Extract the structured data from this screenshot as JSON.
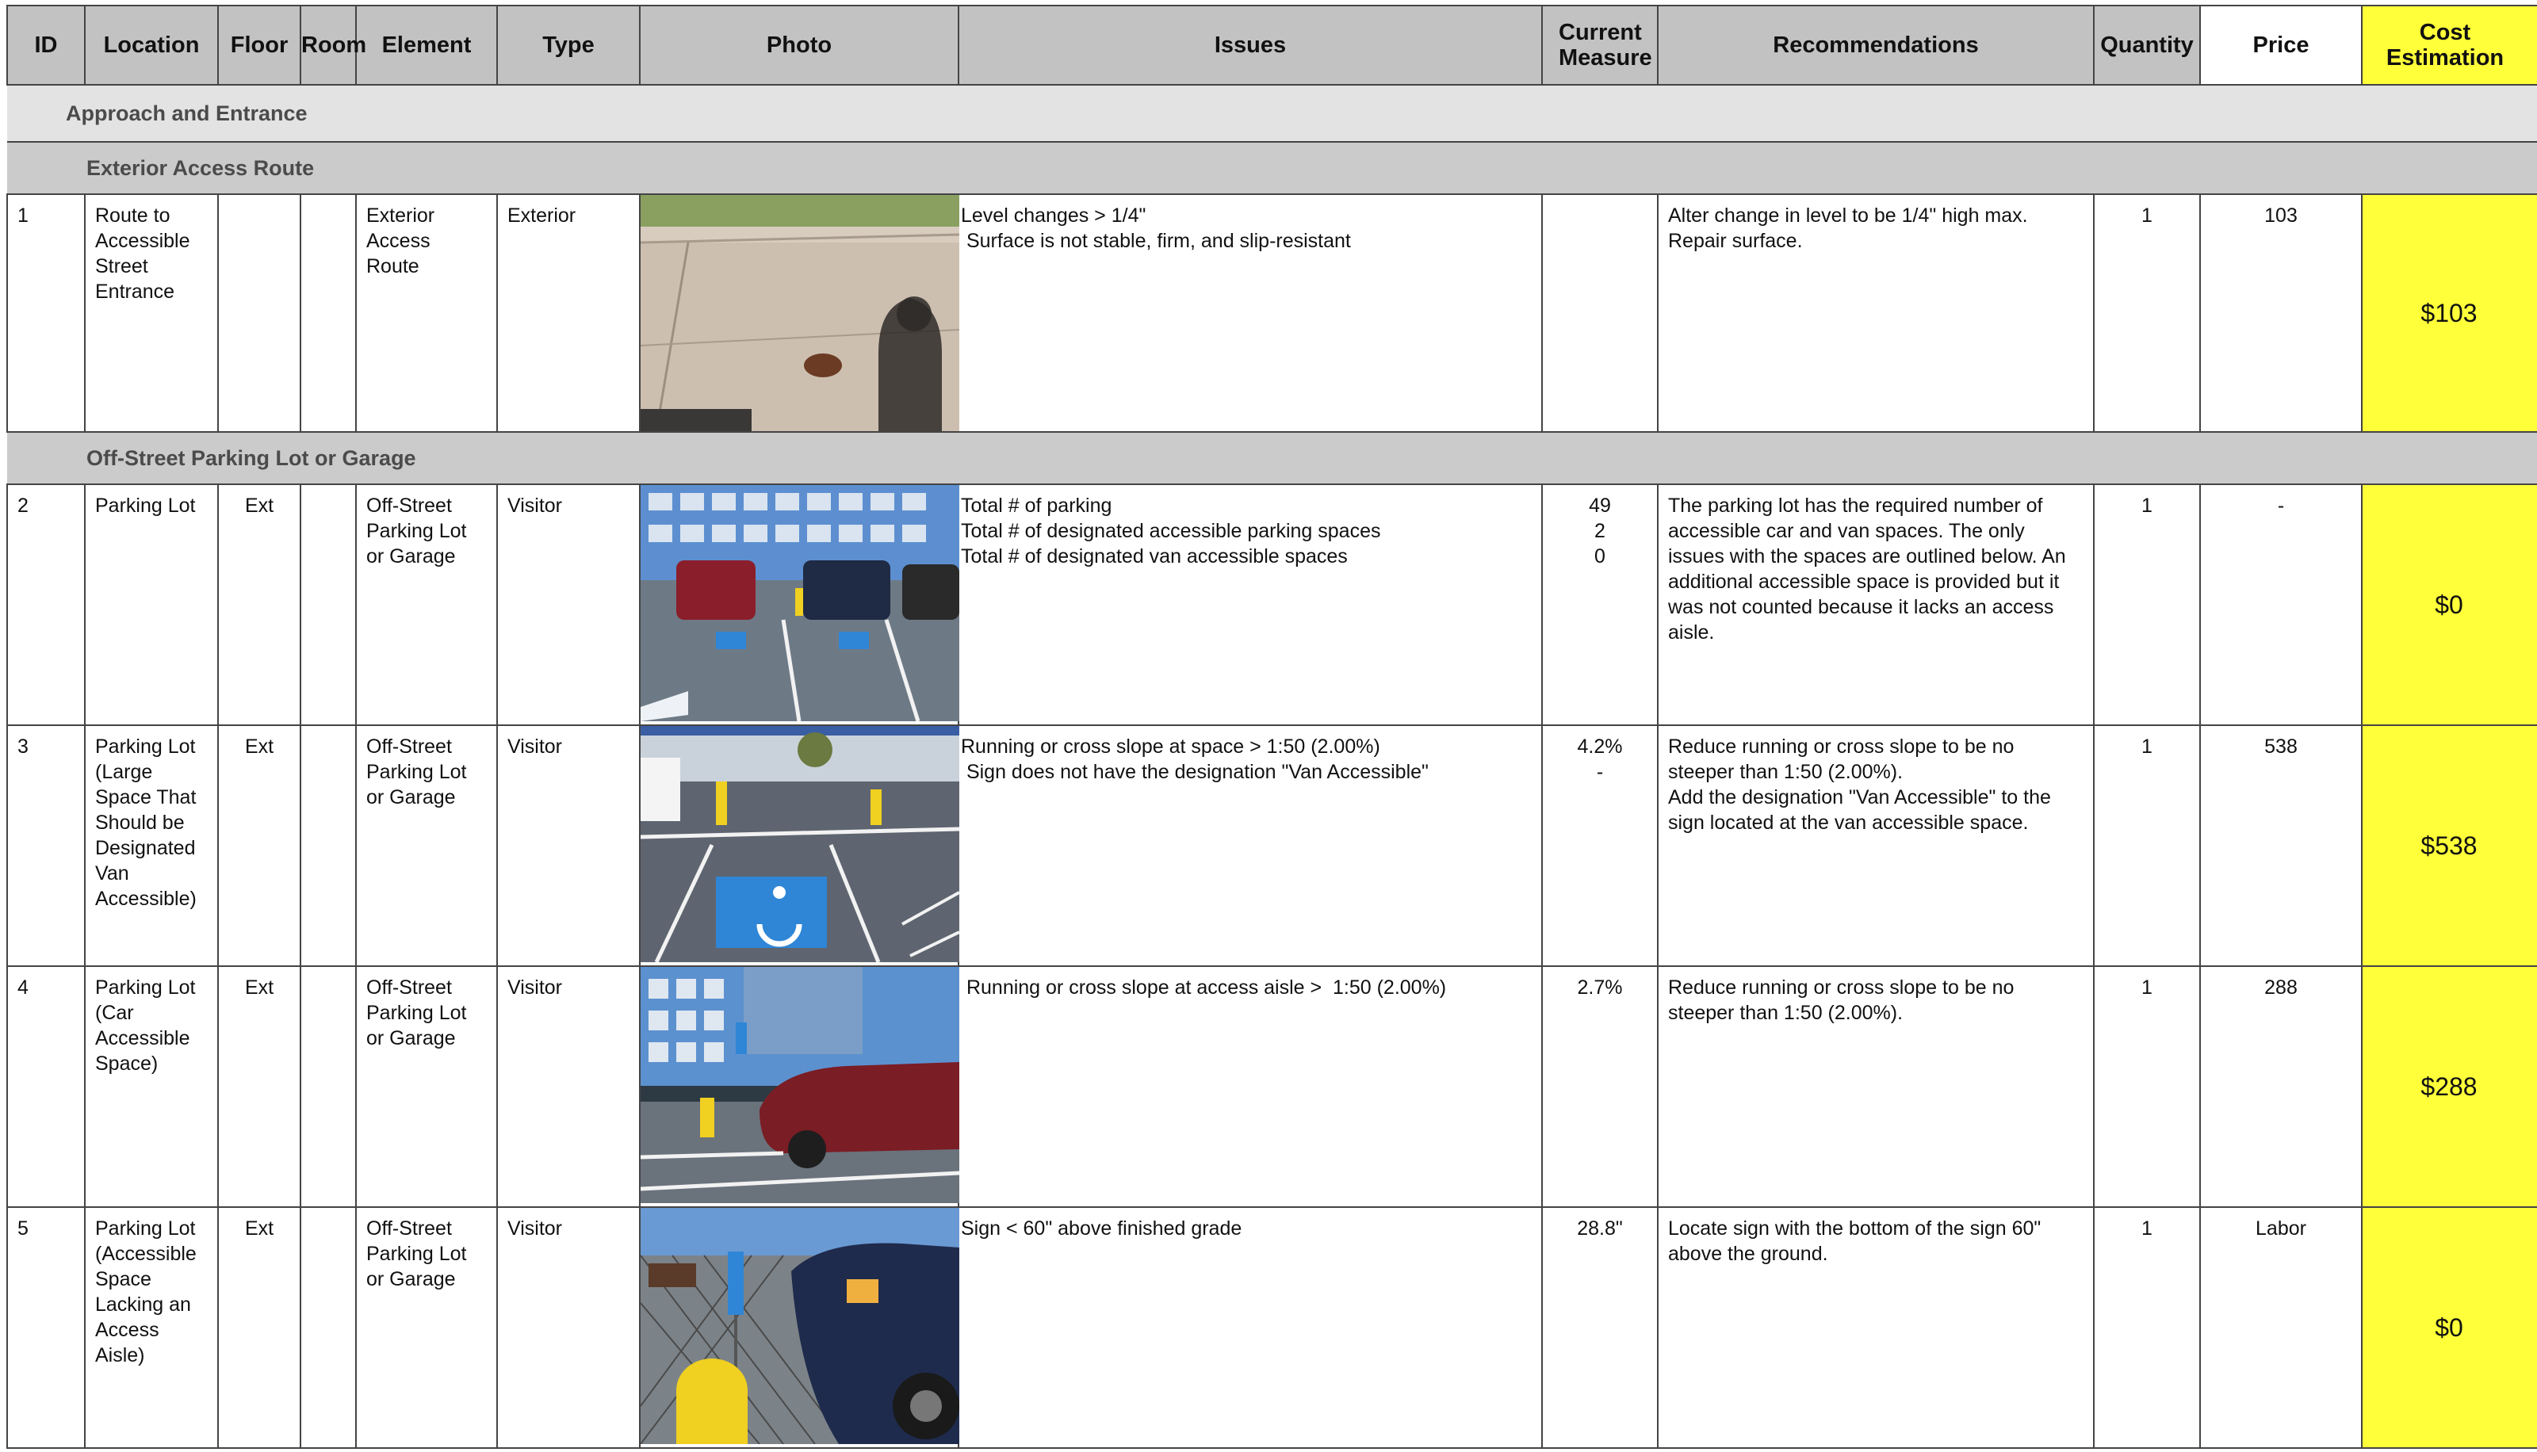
{
  "headers": {
    "id": "ID",
    "location": "Location",
    "floor": "Floor",
    "room": "Room",
    "element": "Element",
    "type": "Type",
    "photo": "Photo",
    "issues": "Issues",
    "current_measure": "Current Measure",
    "recommendations": "Recommendations",
    "quantity": "Quantity",
    "price": "Price",
    "cost_estimation": "Cost Estimation"
  },
  "sections": {
    "approach": "Approach and Entrance",
    "exterior_route": "Exterior Access Route",
    "parking": "Off-Street Parking Lot or Garage"
  },
  "rows": [
    {
      "id": "1",
      "location": "Route to Accessible Street Entrance",
      "floor": "",
      "room": "",
      "element": "Exterior Access Route",
      "type": "Exterior",
      "photo_icon": "sidewalk-photo",
      "issues": [
        "Level changes > 1/4\"",
        " Surface is not stable, firm, and slip-resistant"
      ],
      "measure": [],
      "recommendations": "Alter change in level to be 1/4\" high max.\nRepair surface.",
      "quantity": "1",
      "price": "103",
      "cost": "$103"
    },
    {
      "id": "2",
      "location": "Parking Lot",
      "floor": "Ext",
      "room": "",
      "element": "Off-Street Parking Lot or Garage",
      "type": "Visitor",
      "photo_icon": "parking-lot-photo",
      "issues": [
        "Total # of parking",
        "Total # of designated accessible parking spaces",
        "Total # of designated van accessible spaces"
      ],
      "measure": [
        "49",
        "2",
        "0"
      ],
      "recommendations": "The parking lot has the required number of accessible car and van spaces. The only issues with the spaces are outlined below. An additional accessible space is provided but it was not counted because it lacks an access aisle.",
      "quantity": "1",
      "price": "-",
      "cost": "$0"
    },
    {
      "id": "3",
      "location": "Parking Lot (Large Space That Should be Designated Van Accessible)",
      "floor": "Ext",
      "room": "",
      "element": "Off-Street Parking Lot or Garage",
      "type": "Visitor",
      "photo_icon": "accessible-space-photo",
      "issues": [
        "Running or cross slope at space > 1:50 (2.00%)",
        " Sign does not have the designation \"Van Accessible\""
      ],
      "measure": [
        "4.2%",
        "-"
      ],
      "recommendations": "Reduce running or cross slope to be no steeper than 1:50 (2.00%).\nAdd the designation \"Van Accessible\" to the sign located at the van accessible space.",
      "quantity": "1",
      "price": "538",
      "cost": "$538"
    },
    {
      "id": "4",
      "location": "Parking Lot (Car Accessible Space)",
      "floor": "Ext",
      "room": "",
      "element": "Off-Street Parking Lot or Garage",
      "type": "Visitor",
      "photo_icon": "car-space-photo",
      "issues": [
        " Running or cross slope at access aisle >  1:50 (2.00%)"
      ],
      "measure": [
        "2.7%"
      ],
      "recommendations": "Reduce running or cross slope to be no steeper than 1:50 (2.00%).",
      "quantity": "1",
      "price": "288",
      "cost": "$288"
    },
    {
      "id": "5",
      "location": "Parking Lot (Accessible Space Lacking an Access Aisle)",
      "floor": "Ext",
      "room": "",
      "element": "Off-Street Parking Lot or Garage",
      "type": "Visitor",
      "photo_icon": "sign-photo",
      "issues": [
        "Sign < 60\" above finished grade"
      ],
      "measure": [
        "28.8\""
      ],
      "recommendations": "Locate sign with the bottom of the sign 60\" above the ground.",
      "quantity": "1",
      "price": "Labor",
      "cost": "$0"
    }
  ],
  "colors": {
    "header_bg": "#c2c2c2",
    "cost_highlight": "#ffff3a",
    "section_light": "#e3e3e3",
    "section_dark": "#cbcbcb",
    "accessible_blue": "#2f86d6"
  }
}
